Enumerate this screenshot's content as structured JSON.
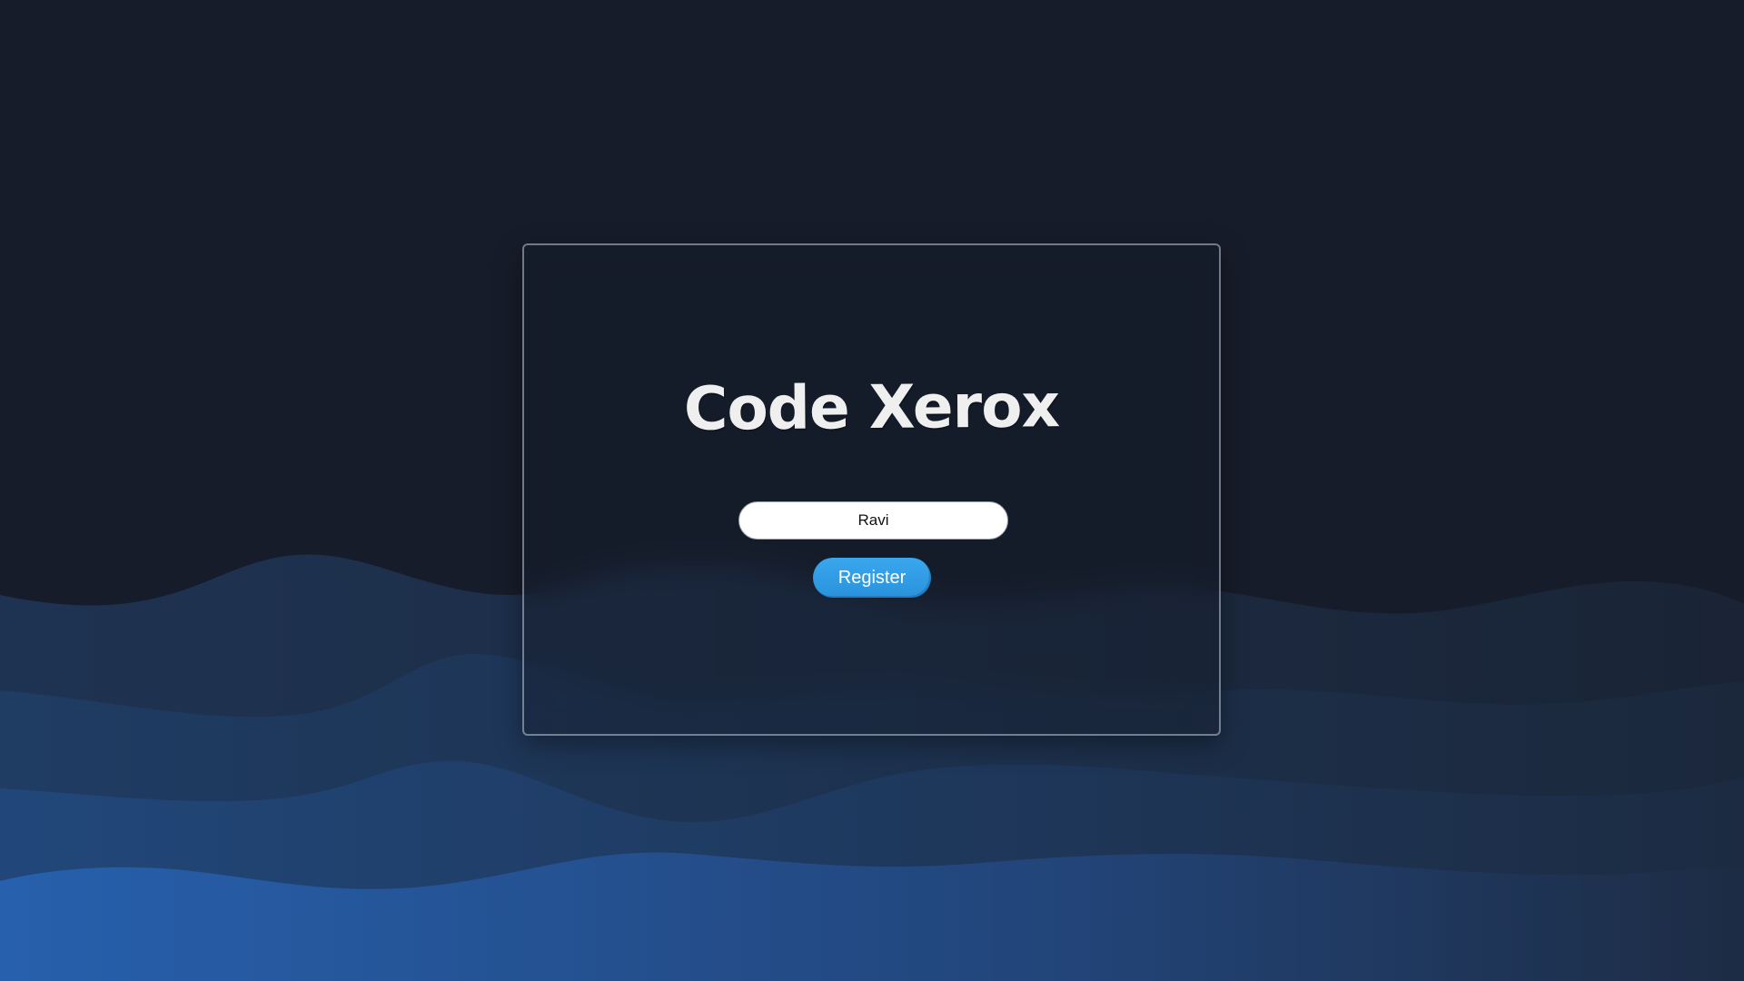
{
  "app": {
    "title": "Code Xerox"
  },
  "form": {
    "name_value": "Ravi",
    "register_label": "Register"
  },
  "colors": {
    "background": "#161c29",
    "accent": "#2f9be4",
    "title_text": "#efefef"
  },
  "icons": {
    "background": "wave-background"
  }
}
